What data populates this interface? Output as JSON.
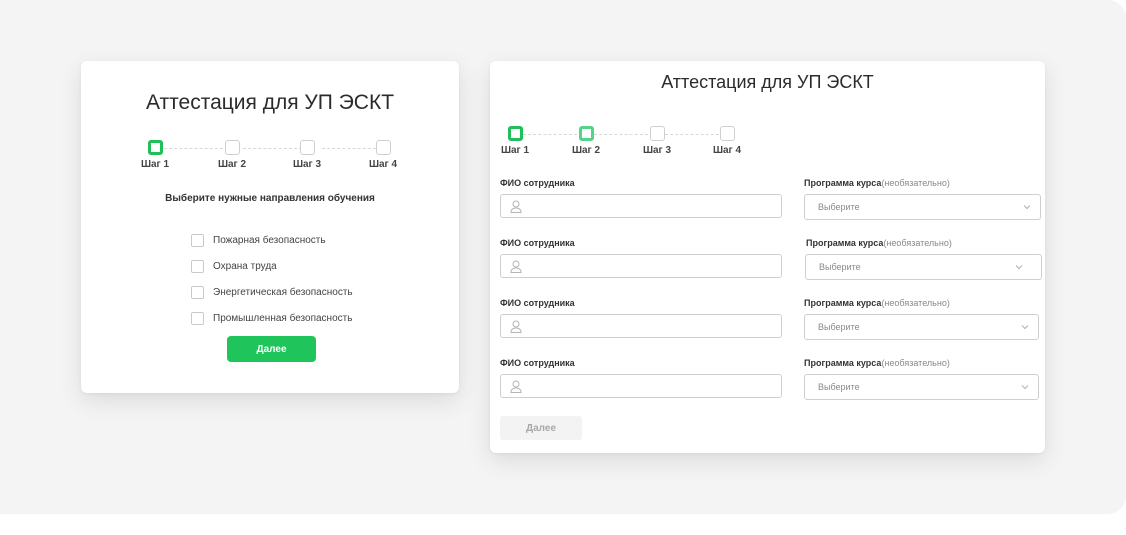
{
  "left_card": {
    "title": "Аттестация для УП ЭСКТ",
    "steps": [
      "Шаг 1",
      "Шаг 2",
      "Шаг 3",
      "Шаг 4"
    ],
    "prompt": "Выберите нужные направления обучения",
    "options": [
      "Пожарная безопасность",
      "Охрана труда",
      "Энергетическая безопасность",
      "Промышленная безопасность"
    ],
    "next_button": "Далее"
  },
  "right_card": {
    "title": "Аттестация для УП ЭСКТ",
    "steps": [
      "Шаг 1",
      "Шаг 2",
      "Шаг 3",
      "Шаг 4"
    ],
    "rows": [
      {
        "name_label": "ФИО сотрудника",
        "program_label": "Программа курса",
        "program_optional": "(необязательно)",
        "select_value": "Выберите"
      },
      {
        "name_label": "ФИО сотрудника",
        "program_label": "Программа курса",
        "program_optional": "(необязательно)",
        "select_value": "Выберите"
      },
      {
        "name_label": "ФИО сотрудника",
        "program_label": "Программа курса",
        "program_optional": "(необязательно)",
        "select_value": "Выберите"
      },
      {
        "name_label": "ФИО сотрудника",
        "program_label": "Программа курса",
        "program_optional": "(необязательно)",
        "select_value": "Выберите"
      }
    ],
    "next_button": "Далее"
  },
  "colors": {
    "accent": "#1fc55b",
    "background": "#f4f4f5"
  },
  "icons": [
    "user-icon",
    "chevron-down-icon"
  ]
}
